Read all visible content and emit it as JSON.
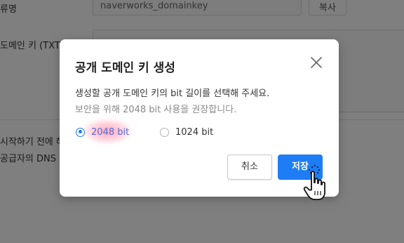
{
  "background": {
    "row1_label": "류명",
    "row1_input_value": "naverworks_domainkey",
    "row1_copy_label": "복사",
    "row2_label": "도메인 키 (TXT",
    "row3_label": "시작하기 전에 해",
    "row4_label": "공급자의 DNS 설"
  },
  "modal": {
    "title": "공개 도메인 키 생성",
    "description_line1": "생성할 공개 도메인 키의 bit 길이를 선택해 주세요.",
    "description_line2": "보안을 위해 2048 bit 사용을 권장합니다.",
    "options": [
      {
        "label": "2048 bit",
        "selected": true
      },
      {
        "label": "1024 bit",
        "selected": false
      }
    ],
    "cancel_label": "취소",
    "save_label": "저장"
  },
  "colors": {
    "accent": "#1e7cf5",
    "overlay": "rgba(0,0,0,0.5)"
  },
  "icons": {
    "close": "close-icon",
    "cursor": "hand-pointer-cursor-icon"
  }
}
